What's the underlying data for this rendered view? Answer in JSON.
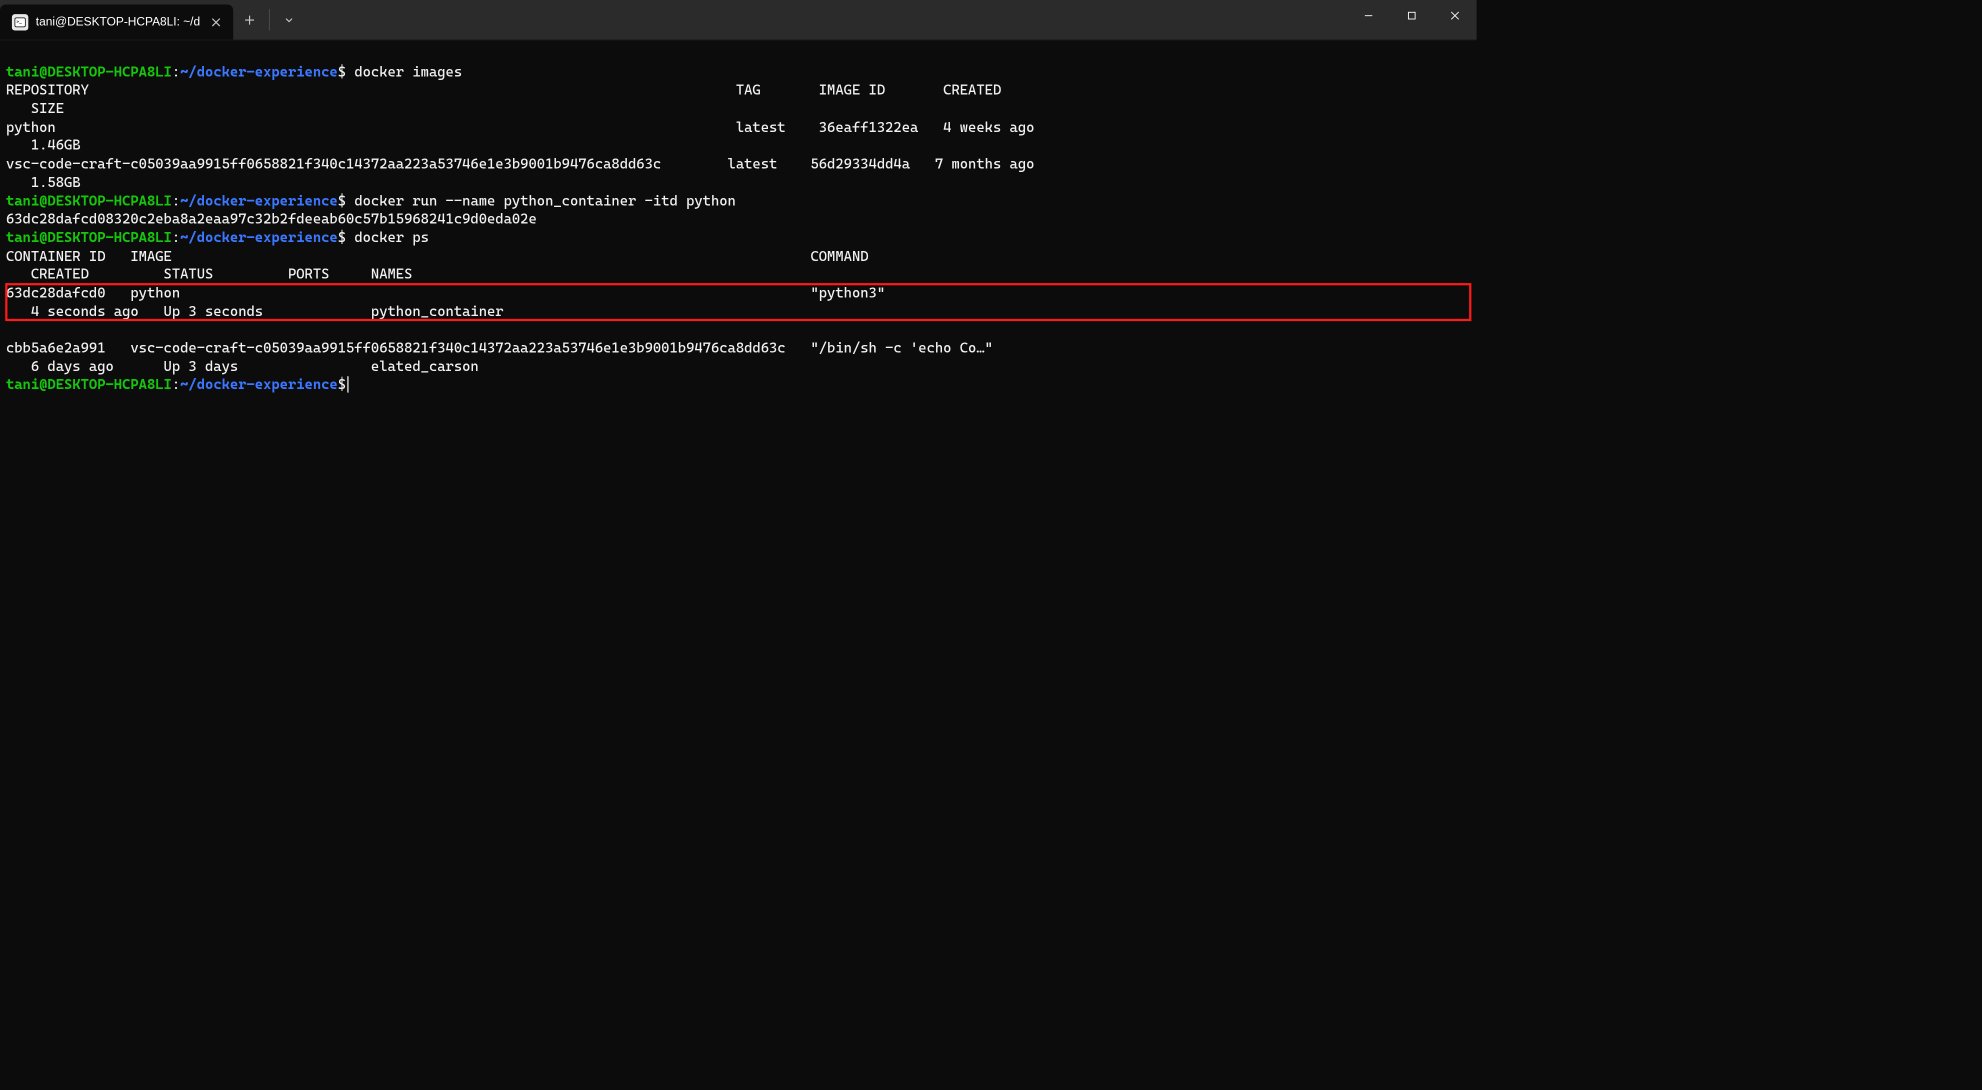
{
  "window": {
    "tab_title": "tani@DESKTOP-HCPA8LI: ~/d",
    "tab_icon_glyph": "C:\\"
  },
  "prompt": {
    "user_host": "tani@DESKTOP-HCPA8LI",
    "colon": ":",
    "path": "~/docker-experience",
    "dollar": "$"
  },
  "commands": {
    "cmd1": " docker images",
    "cmd2": " docker run --name python_container -itd python",
    "cmd3": " docker ps"
  },
  "images_header": "REPOSITORY                                                                              TAG       IMAGE ID       CREATED        \n   SIZE",
  "images_rows": [
    "python                                                                                  latest    36eaff1322ea   4 weeks ago    \n   1.46GB",
    "vsc-code-craft-c05039aa9915ff0658821f340c14372aa223a53746e1e3b9001b9476ca8dd63c        latest    56d29334dd4a   7 months ago   \n   1.58GB"
  ],
  "run_output": "63dc28dafcd08320c2eba8a2eaa97c32b2fdeeab60c57b15968241c9d0eda02e",
  "ps_header": "CONTAINER ID   IMAGE                                                                             COMMAND        \n   CREATED         STATUS         PORTS     NAMES",
  "ps_row_highlight": "63dc28dafcd0   python                                                                            \"python3\"      \n   4 seconds ago   Up 3 seconds             python_container",
  "ps_row_2": "cbb5a6e2a991   vsc-code-craft-c05039aa9915ff0658821f340c14372aa223a53746e1e3b9001b9476ca8dd63c   \"/bin/sh -c 'echo Co…\"\n   6 days ago      Up 3 days                elated_carson"
}
